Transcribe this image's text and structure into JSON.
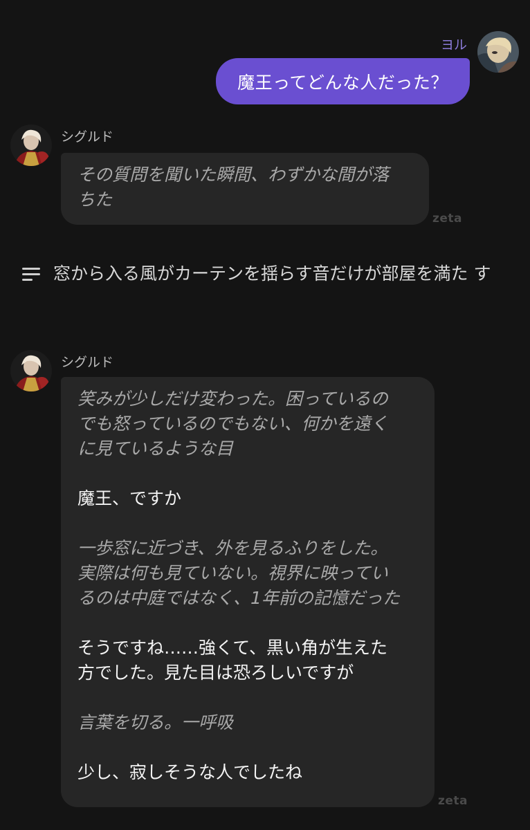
{
  "user": {
    "name": "ヨル",
    "message": "魔王ってどんな人だった？"
  },
  "bot_message_1": {
    "name": "シグルド",
    "text": "その質問を聞いた瞬間、わずかな間が落\nちた",
    "brand": "zeta"
  },
  "system": {
    "text": "窓から入る風がカーテンを揺らす音だけが部屋を満た\nす"
  },
  "bot_message_2": {
    "name": "シグルド",
    "p1": "笑みが少しだけ変わった。困っているの\nでも怒っているのでもない、何かを遠く\nに見ているような目",
    "p2": "魔王、ですか",
    "p3": "一歩窓に近づき、外を見るふりをした。\n実際は何も見ていない。視界に映ってい\nるのは中庭ではなく、1年前の記憶だった",
    "p4": "そうですね……強くて、黒い角が生えた\n方でした。見た目は恐ろしいですが",
    "p5": "言葉を切る。一呼吸",
    "p6": "少し、寂しそうな人でしたね",
    "brand": "zeta"
  },
  "colors": {
    "background": "#141414",
    "user_bubble": "#6a4fd1",
    "bot_bubble": "#262626",
    "user_name": "#8b7bd8"
  },
  "icons": {
    "system": "menu-lines-icon",
    "user_avatar": "user-avatar-photo",
    "bot_avatar": "character-avatar-portrait"
  }
}
